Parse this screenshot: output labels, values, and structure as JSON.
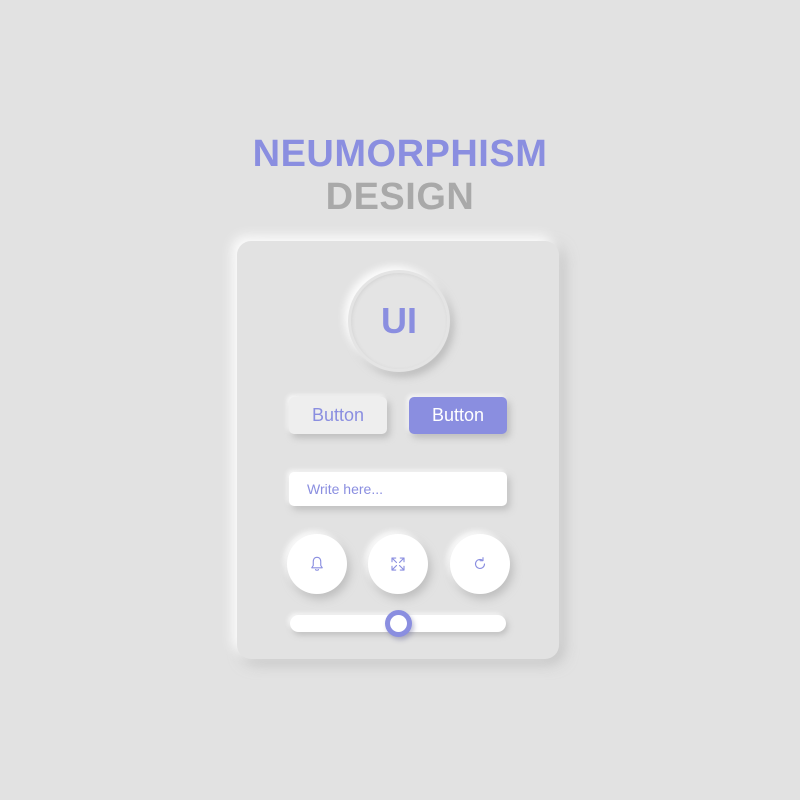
{
  "header": {
    "title_line1": "NEUMORPHISM",
    "title_line2": "DESIGN"
  },
  "badge": {
    "label": "UI"
  },
  "buttons": {
    "secondary_label": "Button",
    "primary_label": "Button"
  },
  "input": {
    "placeholder": "Write here...",
    "value": ""
  },
  "icon_buttons": [
    {
      "icon": "bell-icon"
    },
    {
      "icon": "fullscreen-icon"
    },
    {
      "icon": "refresh-icon"
    }
  ],
  "slider": {
    "value_fraction": 0.5
  },
  "colors": {
    "accent": "#8a8ee0",
    "muted_text": "#a9a9a9",
    "background": "#e2e2e2",
    "surface": "#ffffff"
  }
}
